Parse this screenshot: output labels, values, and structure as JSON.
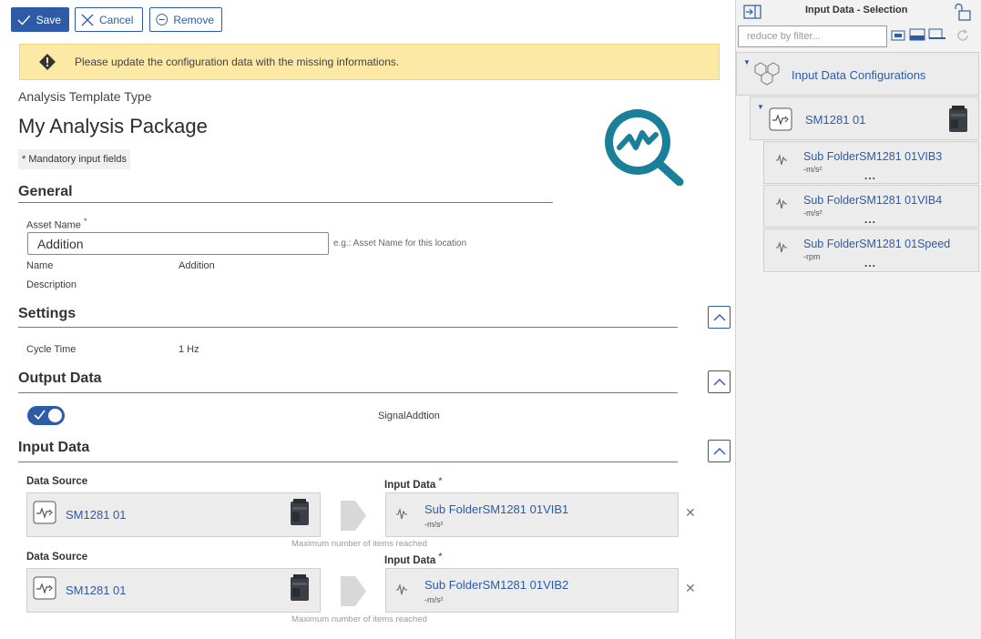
{
  "toolbar": {
    "save": "Save",
    "cancel": "Cancel",
    "remove": "Remove"
  },
  "warning": {
    "text": "Please update the configuration data with the missing informations."
  },
  "header": {
    "template_type": "Analysis Template Type",
    "package_title": "My Analysis Package",
    "mandatory_note": "* Mandatory input fields"
  },
  "general": {
    "title": "General",
    "asset_name_label": "Asset Name",
    "required_mark": "*",
    "asset_name_value": "Addition",
    "asset_name_hint": "e.g.: Asset Name for this location",
    "name_label": "Name",
    "name_value": "Addition",
    "description_label": "Description"
  },
  "settings": {
    "title": "Settings",
    "cycle_time_label": "Cycle Time",
    "cycle_time_value": "1 Hz"
  },
  "output": {
    "title": "Output Data",
    "toggle_on": true,
    "signal_name": "SignalAddtion"
  },
  "input": {
    "title": "Input Data",
    "rows": [
      {
        "source_label": "Data Source",
        "source_value": "SM1281 01",
        "input_label": "Input Data",
        "input_value": "Sub FolderSM1281 01VIB1",
        "input_unit": "-m/s²",
        "max_note": "Maximum number of items reached"
      },
      {
        "source_label": "Data Source",
        "source_value": "SM1281 01",
        "input_label": "Input Data",
        "input_value": "Sub FolderSM1281 01VIB2",
        "input_unit": "-m/s²",
        "max_note": "Maximum number of items reached"
      }
    ]
  },
  "right_panel": {
    "title": "Input Data - Selection",
    "filter_placeholder": "reduce by filter...",
    "root": "Input Data Configurations",
    "device": "SM1281 01",
    "items": [
      {
        "name": "Sub FolderSM1281 01VIB3",
        "unit": "-m/s²"
      },
      {
        "name": "Sub FolderSM1281 01VIB4",
        "unit": "-m/s²"
      },
      {
        "name": "Sub FolderSM1281 01Speed",
        "unit": "-rpm"
      }
    ],
    "more": "..."
  },
  "colors": {
    "accent": "#2d5ba7",
    "logo": "#1b7f99",
    "warning_bg": "#fbe9a5"
  },
  "icons": [
    "check-icon",
    "close-icon",
    "minus-circle-icon",
    "warning-icon",
    "chevron-up-icon",
    "signal-icon",
    "waveform-icon",
    "device-icon",
    "tree-network-icon",
    "collapse-panel-icon",
    "lock-open-icon",
    "refresh-icon"
  ]
}
